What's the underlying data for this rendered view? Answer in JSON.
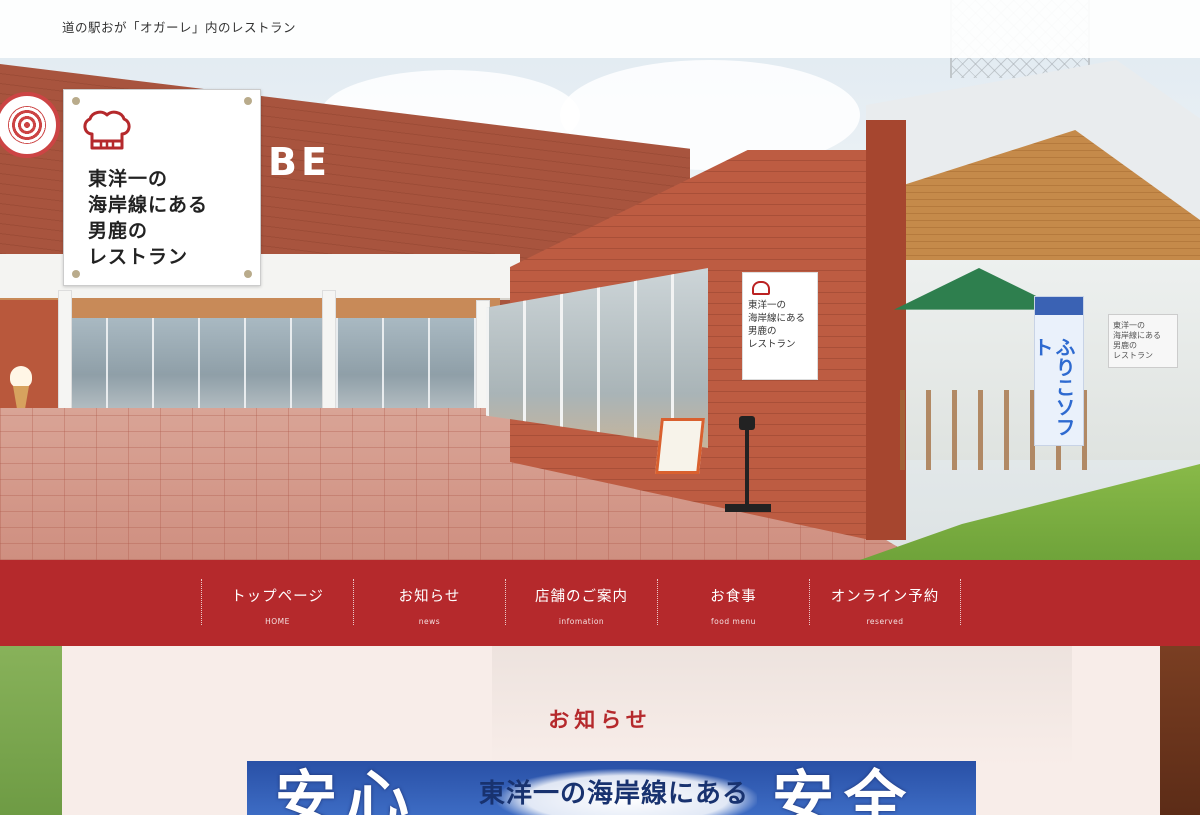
{
  "header": {
    "tagline": "道の駅おが「オガーレ」内のレストラン"
  },
  "hero": {
    "building_letters": "BE",
    "restaurant_sign": [
      "東洋一の",
      "海岸線にある",
      "男鹿の",
      "レストラン"
    ],
    "pavilion_sign": [
      "東洋一の",
      "海岸線にある",
      "男鹿の",
      "レストラン"
    ],
    "banner_flag_text": "ふりこソフト"
  },
  "logo": {
    "icon": "chef-hat-icon",
    "lines": [
      "東洋一の",
      "海岸線にある",
      "男鹿の",
      "レストラン"
    ]
  },
  "nav": {
    "items": [
      {
        "label": "トップページ",
        "sub": "HOME"
      },
      {
        "label": "お知らせ",
        "sub": "news"
      },
      {
        "label": "店舗のご案内",
        "sub": "infomation"
      },
      {
        "label": "お食事",
        "sub": "food menu"
      },
      {
        "label": "オンライン予約",
        "sub": "reserved"
      }
    ]
  },
  "news": {
    "title": "お知らせ",
    "banner": {
      "left": "安心",
      "headline": "東洋一の海岸線にある",
      "right": "安全"
    }
  },
  "colors": {
    "accent": "#b5292c",
    "banner_blue": "#2950a6"
  }
}
